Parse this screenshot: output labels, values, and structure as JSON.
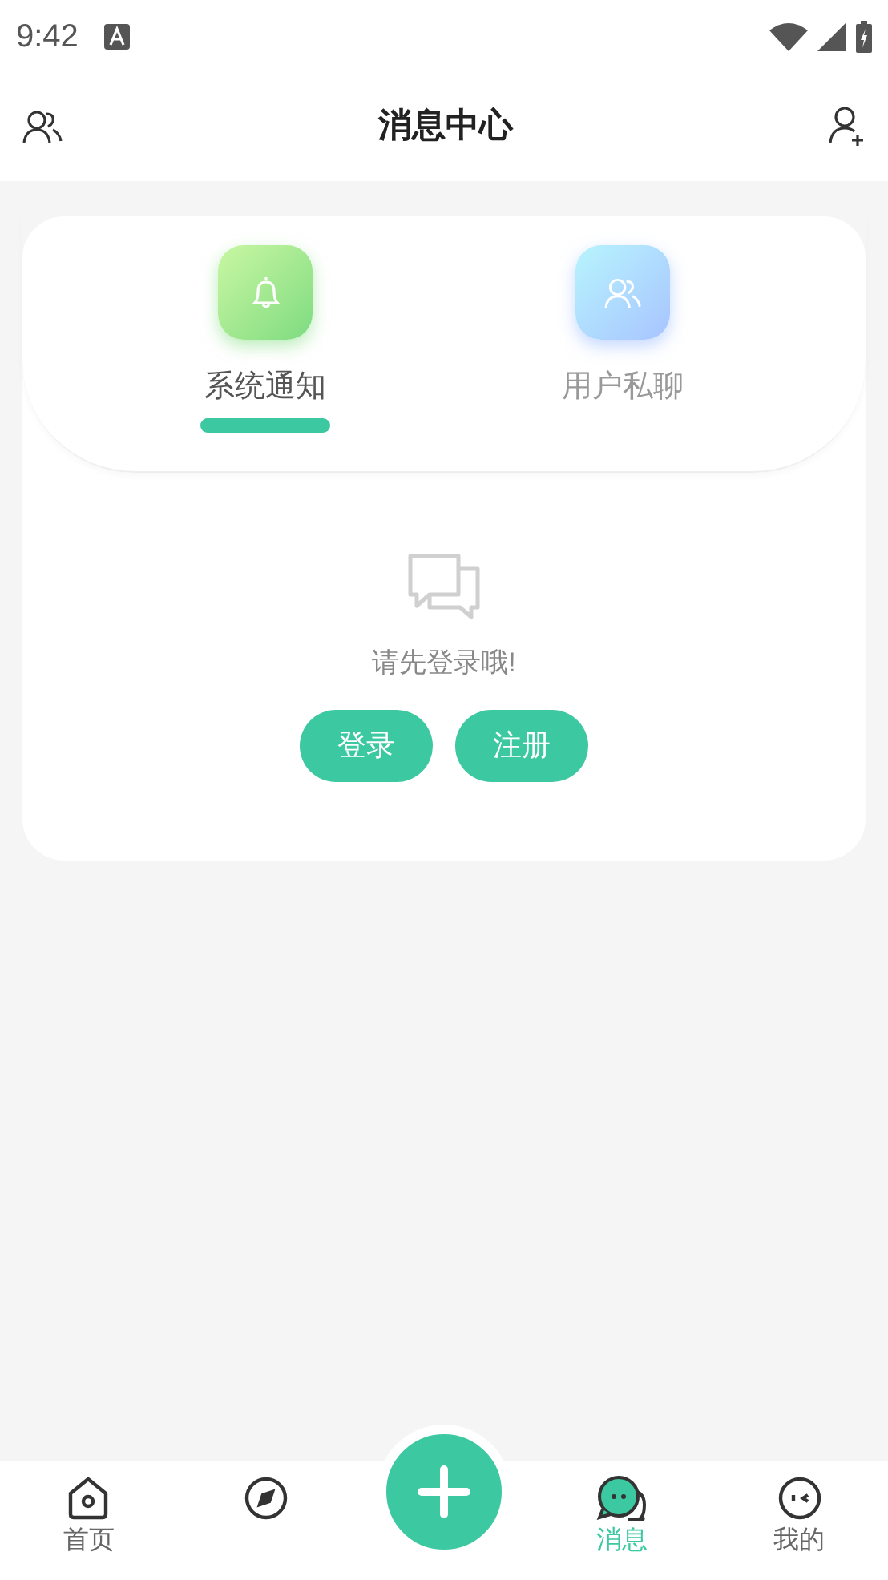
{
  "status_bar": {
    "time": "9:42"
  },
  "header": {
    "title": "消息中心"
  },
  "tabs": [
    {
      "label": "系统通知",
      "selected": true
    },
    {
      "label": "用户私聊",
      "selected": false
    }
  ],
  "empty_state": {
    "message": "请先登录哦!",
    "buttons": [
      "登录",
      "注册"
    ]
  },
  "bottom_nav": [
    {
      "kind": "tab",
      "label": "首页",
      "selected": false
    },
    {
      "kind": "tab",
      "selected": false
    },
    {
      "kind": "add"
    },
    {
      "kind": "tab",
      "label": "消息",
      "selected": true
    },
    {
      "kind": "tab",
      "label": "我的",
      "selected": false
    }
  ]
}
